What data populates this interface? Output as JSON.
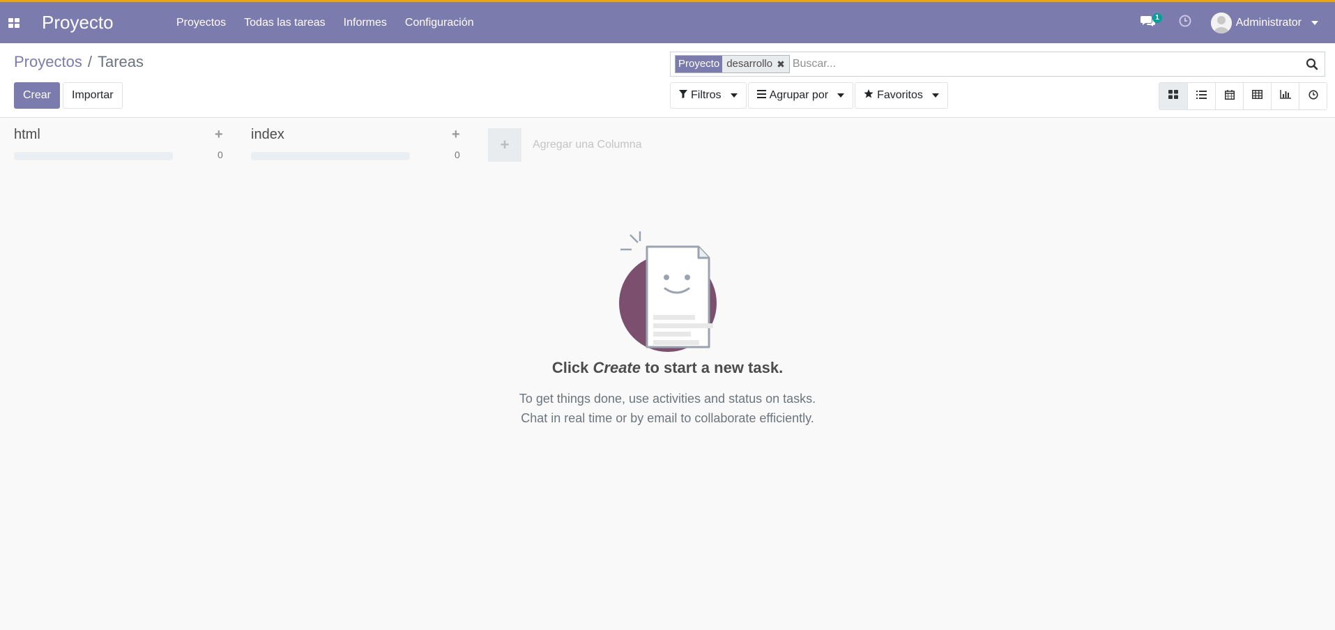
{
  "app": {
    "brand": "Proyecto",
    "accent": "#7c7bad",
    "top_border": "#f0a500"
  },
  "nav": {
    "items": [
      "Proyectos",
      "Todas las tareas",
      "Informes",
      "Configuración"
    ]
  },
  "systray": {
    "messages_count": "1",
    "user_name": "Administrator"
  },
  "breadcrumb": {
    "parent": "Proyectos",
    "separator": "/",
    "current": "Tareas"
  },
  "actions": {
    "create_label": "Crear",
    "import_label": "Importar"
  },
  "search": {
    "facet_label": "Proyecto",
    "facet_value": "desarrollo",
    "placeholder": "Buscar..."
  },
  "filters": {
    "filters_label": "Filtros",
    "groupby_label": "Agrupar por",
    "favorites_label": "Favoritos"
  },
  "views": [
    "kanban-icon",
    "list-icon",
    "calendar-icon",
    "pivot-icon",
    "graph-icon",
    "activity-icon"
  ],
  "kanban": {
    "columns": [
      {
        "title": "html",
        "count": "0"
      },
      {
        "title": "index",
        "count": "0"
      }
    ],
    "add_column_label": "Agregar una Columna"
  },
  "helper": {
    "title_pre": "Click ",
    "title_em": "Create",
    "title_post": " to start a new task.",
    "line1": "To get things done, use activities and status on tasks.",
    "line2": "Chat in real time or by email to collaborate efficiently."
  }
}
